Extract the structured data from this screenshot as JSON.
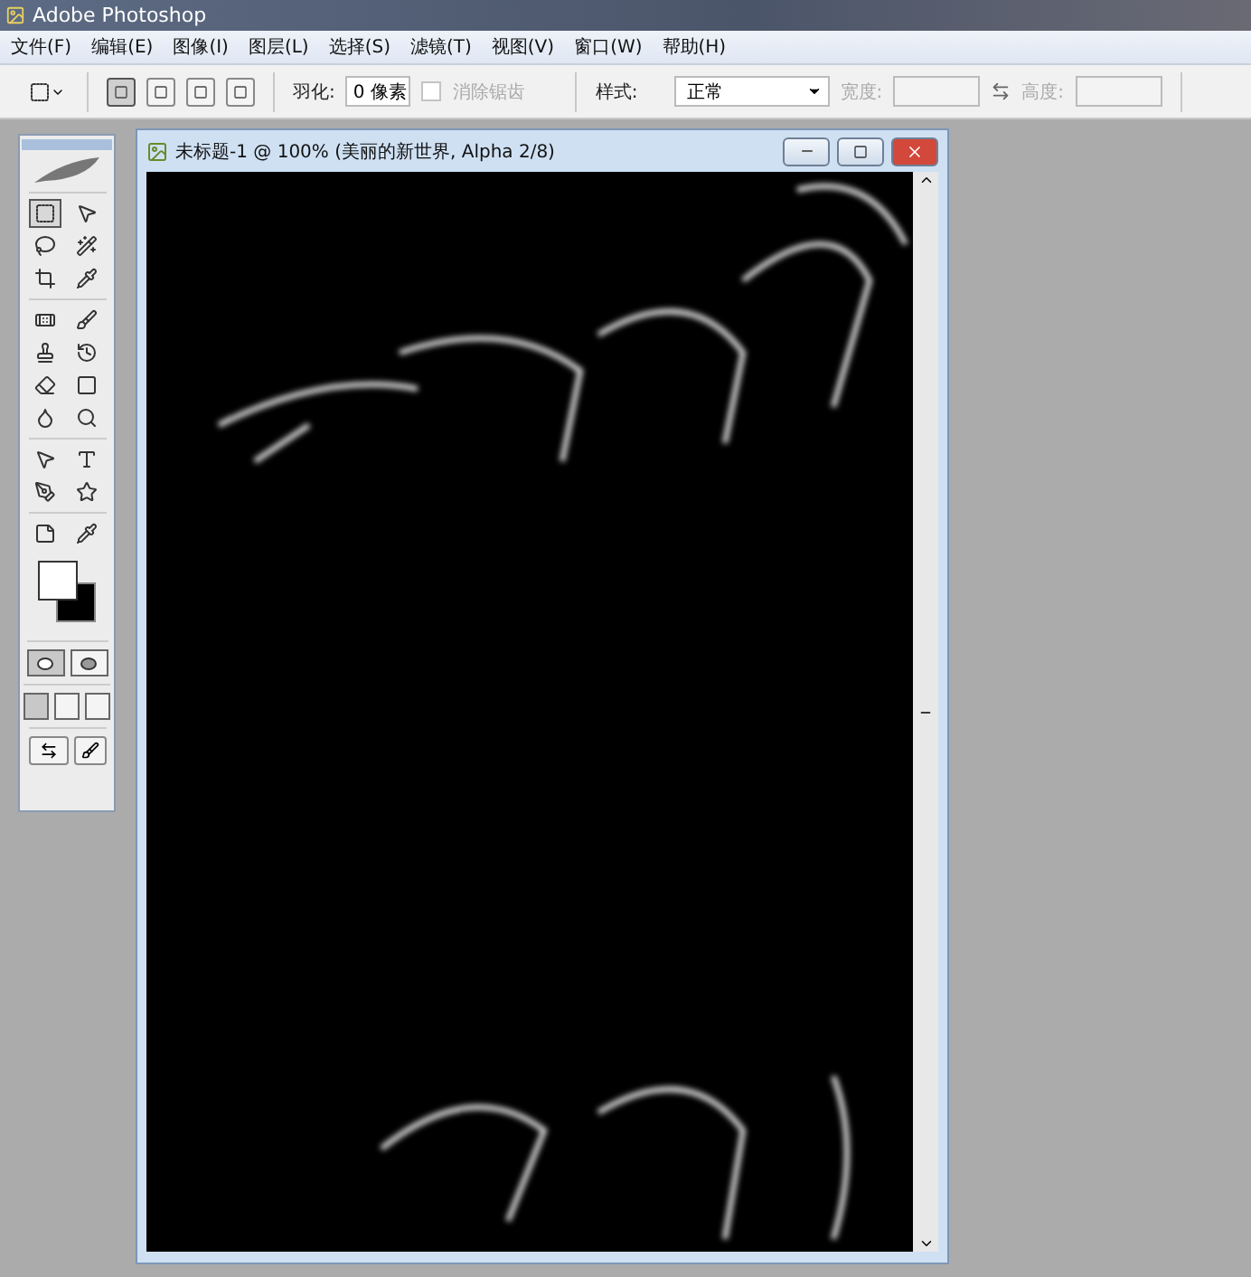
{
  "app_title": "Adobe Photoshop",
  "menu": [
    "文件(F)",
    "编辑(E)",
    "图像(I)",
    "图层(L)",
    "选择(S)",
    "滤镜(T)",
    "视图(V)",
    "窗口(W)",
    "帮助(H)"
  ],
  "options": {
    "modes": [
      {
        "selected": true
      },
      {
        "selected": false
      },
      {
        "selected": false
      },
      {
        "selected": false
      }
    ],
    "feather_label": "羽化:",
    "feather_value": "0 像素",
    "antialias": {
      "label": "消除锯齿",
      "checked": false,
      "disabled": true
    },
    "style_label": "样式:",
    "style_value": "正常",
    "width_label": "宽度:",
    "height_label": "高度:",
    "size_disabled": true
  },
  "tools": [
    {
      "selected": true
    },
    {
      "selected": false
    },
    {
      "selected": false
    },
    {
      "selected": false
    },
    {
      "selected": false
    },
    {
      "selected": false
    },
    {
      "selected": false
    },
    {
      "selected": false
    },
    {
      "selected": false
    },
    {
      "selected": false
    },
    {
      "selected": false
    },
    {
      "selected": false
    },
    {
      "selected": false
    },
    {
      "selected": false
    },
    {
      "selected": false
    },
    {
      "selected": false
    },
    {
      "selected": false
    },
    {
      "selected": false
    },
    {
      "selected": false
    },
    {
      "selected": false
    }
  ],
  "quick_mask": [
    {
      "selected": true
    },
    {
      "selected": false
    }
  ],
  "screen_modes": [
    {
      "selected": true
    },
    {
      "selected": false
    },
    {
      "selected": false
    }
  ],
  "document": {
    "title": "未标题-1 @ 100% (美丽的新世界, Alpha 2/8)"
  }
}
